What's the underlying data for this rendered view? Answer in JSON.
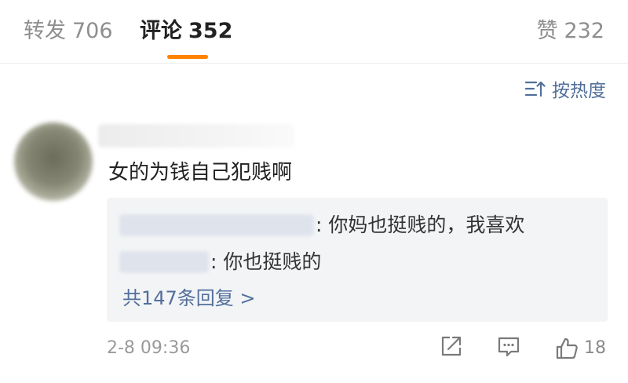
{
  "tabs": {
    "repost_label": "转发",
    "repost_count": "706",
    "comments_label": "评论",
    "comments_count": "352",
    "likes_label": "赞",
    "likes_count": "232",
    "active": "comments"
  },
  "sort": {
    "label": "按热度",
    "icon": "sort-icon"
  },
  "comment": {
    "text": "女的为钱自己犯贱啊",
    "timestamp": "2-8 09:36",
    "replies": [
      {
        "text": ": 你妈也挺贱的，我喜欢"
      },
      {
        "text": ": 你也挺贱的"
      }
    ],
    "more_replies": "共147条回复 >",
    "actions": {
      "share_icon": "share-icon",
      "reply_icon": "comment-icon",
      "like_icon": "thumbs-up-icon",
      "like_count": "18"
    }
  },
  "colors": {
    "accent": "#ff8200",
    "link": "#526f9b",
    "reply_background": "#f3f4f6"
  }
}
